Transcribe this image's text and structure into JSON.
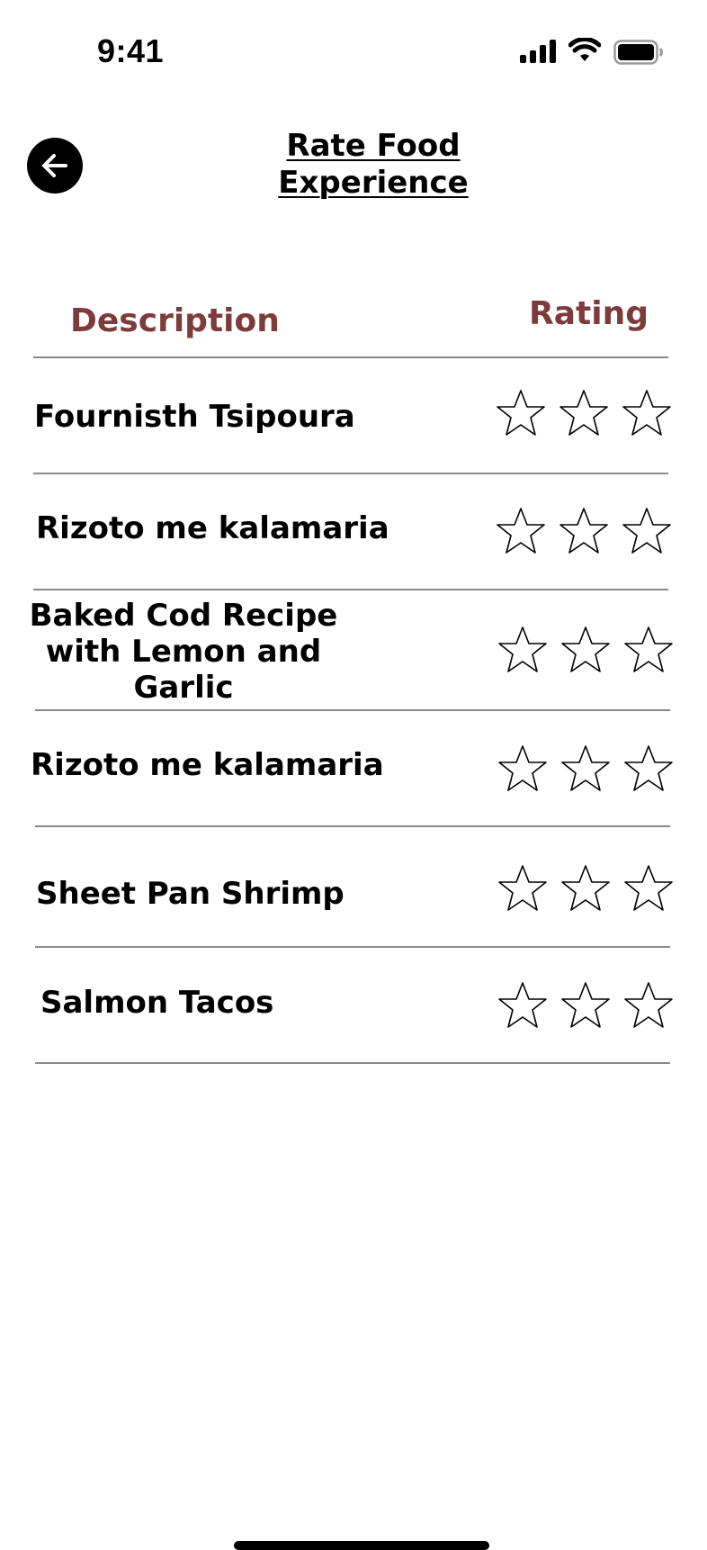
{
  "status_bar": {
    "time": "9:41"
  },
  "header": {
    "title": "Rate Food Experience",
    "back_icon": "arrow-left-icon"
  },
  "columns": {
    "description": "Description",
    "rating": "Rating"
  },
  "items": [
    {
      "name": "Fournisth Tsipoura",
      "rating": 0,
      "max_rating": 3
    },
    {
      "name": "Rizoto me kalamaria",
      "rating": 0,
      "max_rating": 3
    },
    {
      "name": "Baked Cod Recipe with Lemon and Garlic",
      "rating": 0,
      "max_rating": 3
    },
    {
      "name": "Rizoto me kalamaria",
      "rating": 0,
      "max_rating": 3
    },
    {
      "name": "Sheet Pan Shrimp",
      "rating": 0,
      "max_rating": 3
    },
    {
      "name": "Salmon Tacos",
      "rating": 0,
      "max_rating": 3
    }
  ],
  "colors": {
    "accent": "#7d3b3b",
    "divider": "#8a8a8a",
    "text": "#000000"
  }
}
